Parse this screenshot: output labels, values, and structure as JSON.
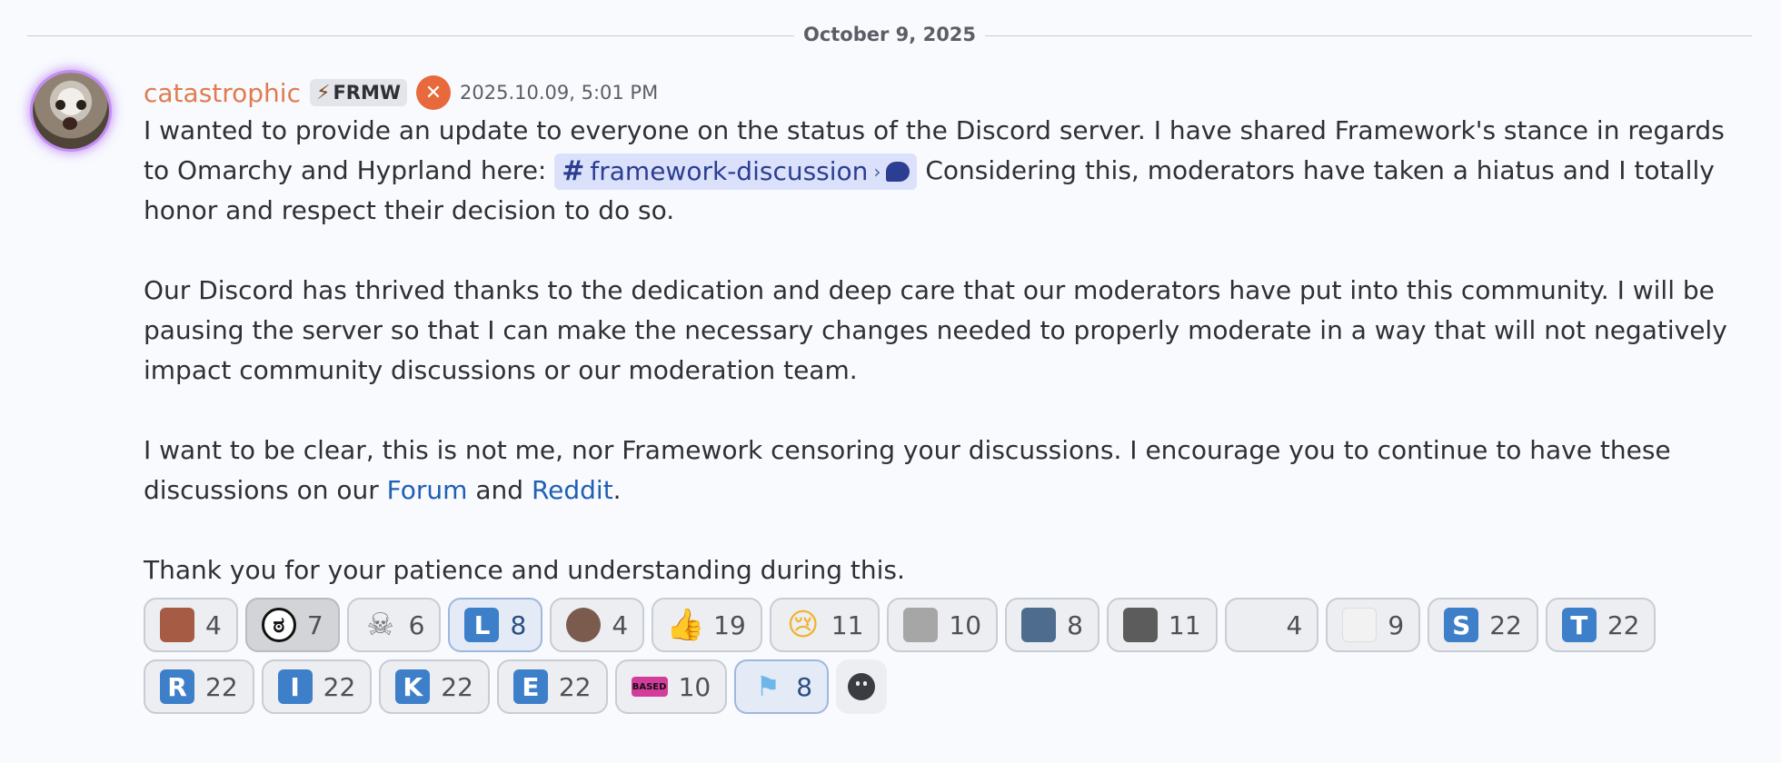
{
  "divider": {
    "date": "October 9, 2025"
  },
  "message": {
    "username": "catastrophic",
    "tag": "FRMW",
    "tag_icon": "lightning-bolt-icon",
    "badge_icon": "framework-cog-icon",
    "timestamp": "2025.10.09, 5:01 PM",
    "p1_before": "I wanted to provide an update to everyone on the status of the Discord server. I have shared Framework's stance in regards to Omarchy and Hyprland here: ",
    "channel_mention": "framework-discussion",
    "p1_after": " Considering this, moderators have taken a hiatus and I totally honor and respect their decision to do so.",
    "p2": "Our Discord has thrived thanks to the dedication and deep care that our moderators have put into this community. I will be pausing the server so that I can make the necessary changes needed to properly moderate in a way that will not negatively impact community discussions or our moderation team.",
    "p3_before": "I want to be clear, this is not me, nor Framework censoring your discussions. I encourage you to continue to have these discussions on our ",
    "link_forum": "Forum",
    "p3_mid": " and ",
    "link_reddit": "Reddit",
    "p3_after": ".",
    "p4": "Thank you for your patience and understanding during this."
  },
  "reactions": [
    {
      "emoji": "person-photo",
      "count": "4"
    },
    {
      "emoji": "rage-face",
      "count": "7"
    },
    {
      "emoji": "skull",
      "count": "6"
    },
    {
      "emoji": "letter-L",
      "label": "L",
      "count": "8"
    },
    {
      "emoji": "hamster",
      "count": "4"
    },
    {
      "emoji": "thumbs-up",
      "count": "19"
    },
    {
      "emoji": "crying-face",
      "count": "11"
    },
    {
      "emoji": "knife-hand",
      "count": "10"
    },
    {
      "emoji": "blue-character",
      "count": "8"
    },
    {
      "emoji": "cat-photo",
      "count": "11"
    },
    {
      "emoji": "blank",
      "count": "4"
    },
    {
      "emoji": "tiny-square",
      "count": "9"
    },
    {
      "emoji": "letter-S",
      "label": "S",
      "count": "22"
    },
    {
      "emoji": "letter-T",
      "label": "T",
      "count": "22"
    },
    {
      "emoji": "letter-R",
      "label": "R",
      "count": "22"
    },
    {
      "emoji": "letter-I",
      "label": "I",
      "count": "22"
    },
    {
      "emoji": "letter-K",
      "label": "K",
      "count": "22"
    },
    {
      "emoji": "letter-E",
      "label": "E",
      "count": "22"
    },
    {
      "emoji": "based-sticker",
      "label": "BASED",
      "count": "10"
    },
    {
      "emoji": "trans-flag",
      "count": "8"
    }
  ],
  "colors": {
    "username": "#e07c50",
    "link": "#1f5fb4",
    "mention_bg": "#dbe1fb",
    "letter_emoji": "#3d7fc9"
  }
}
